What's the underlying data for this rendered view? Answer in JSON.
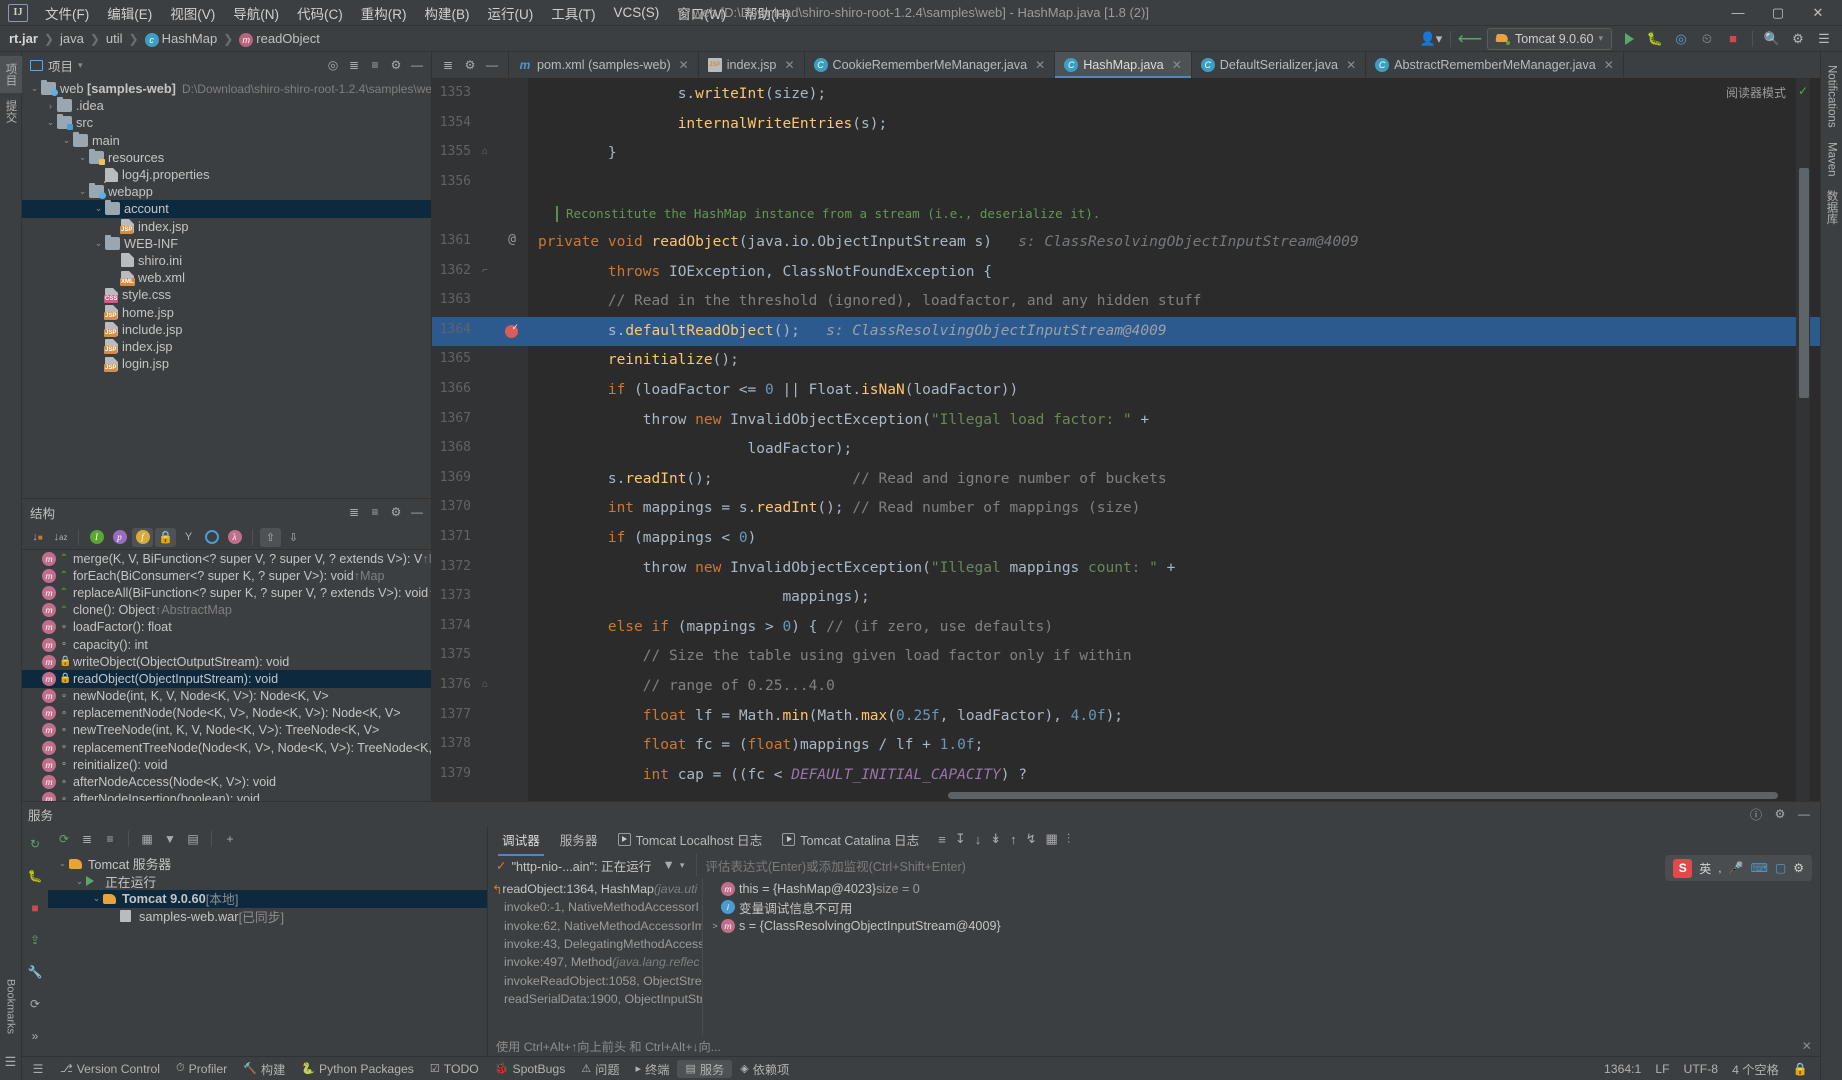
{
  "window": {
    "title": "web [D:\\Download\\shiro-shiro-root-1.2.4\\samples\\web] - HashMap.java [1.8 (2)]",
    "logo": "IJ",
    "minimize": "—",
    "maximize": "▢",
    "close": "✕"
  },
  "menu": [
    "文件(F)",
    "编辑(E)",
    "视图(V)",
    "导航(N)",
    "代码(C)",
    "重构(R)",
    "构建(B)",
    "运行(U)",
    "工具(T)",
    "VCS(S)",
    "窗口(W)",
    "帮助(H)"
  ],
  "breadcrumb": [
    {
      "label": "rt.jar",
      "bold": true,
      "icon": ""
    },
    {
      "label": "java",
      "bold": false,
      "icon": ""
    },
    {
      "label": "util",
      "bold": false,
      "icon": ""
    },
    {
      "label": "HashMap",
      "bold": false,
      "icon": "c"
    },
    {
      "label": "readObject",
      "bold": false,
      "icon": "m"
    }
  ],
  "toolbar": {
    "run_config": "Tomcat 9.0.60",
    "icons": [
      "user-icon",
      "vcs-update-icon",
      "run-icon",
      "debug-icon",
      "coverage-icon",
      "profiler-icon",
      "stop-icon",
      "search-icon",
      "settings-icon",
      "more-icon"
    ]
  },
  "left_rail": {
    "tabs": [
      "项目",
      "提交"
    ],
    "right_tabs": [
      "Notifications",
      "Maven",
      "数据库"
    ]
  },
  "project_panel": {
    "title": "项目",
    "tree": [
      {
        "depth": 0,
        "arrow": "v",
        "icon": "folder web",
        "label": "web",
        "bold": "[samples-web]",
        "dim": "D:\\Download\\shiro-shiro-root-1.2.4\\samples\\we",
        "sel": false
      },
      {
        "depth": 1,
        "arrow": ">",
        "icon": "folder",
        "label": ".idea",
        "bold": "",
        "dim": "",
        "sel": false
      },
      {
        "depth": 1,
        "arrow": "v",
        "icon": "folder src",
        "label": "src",
        "bold": "",
        "dim": "",
        "sel": false
      },
      {
        "depth": 2,
        "arrow": "v",
        "icon": "folder",
        "label": "main",
        "bold": "",
        "dim": "",
        "sel": false
      },
      {
        "depth": 3,
        "arrow": "v",
        "icon": "folder res",
        "label": "resources",
        "bold": "",
        "dim": "",
        "sel": false
      },
      {
        "depth": 4,
        "arrow": "",
        "icon": "file prop",
        "label": "log4j.properties",
        "bold": "",
        "dim": "",
        "sel": false
      },
      {
        "depth": 3,
        "arrow": "v",
        "icon": "folder web",
        "label": "webapp",
        "bold": "",
        "dim": "",
        "sel": false
      },
      {
        "depth": 4,
        "arrow": "v",
        "icon": "folder",
        "label": "account",
        "bold": "",
        "dim": "",
        "sel": true
      },
      {
        "depth": 5,
        "arrow": "",
        "icon": "file jsp",
        "label": "index.jsp",
        "bold": "",
        "dim": "",
        "sel": false
      },
      {
        "depth": 4,
        "arrow": "v",
        "icon": "folder",
        "label": "WEB-INF",
        "bold": "",
        "dim": "",
        "sel": false
      },
      {
        "depth": 5,
        "arrow": "",
        "icon": "file",
        "label": "shiro.ini",
        "bold": "",
        "dim": "",
        "sel": false
      },
      {
        "depth": 5,
        "arrow": "",
        "icon": "file xml",
        "label": "web.xml",
        "bold": "",
        "dim": "",
        "sel": false
      },
      {
        "depth": 4,
        "arrow": "",
        "icon": "file css",
        "label": "style.css",
        "bold": "",
        "dim": "",
        "sel": false
      },
      {
        "depth": 4,
        "arrow": "",
        "icon": "file jsp",
        "label": "home.jsp",
        "bold": "",
        "dim": "",
        "sel": false
      },
      {
        "depth": 4,
        "arrow": "",
        "icon": "file jsp",
        "label": "include.jsp",
        "bold": "",
        "dim": "",
        "sel": false
      },
      {
        "depth": 4,
        "arrow": "",
        "icon": "file jsp",
        "label": "index.jsp",
        "bold": "",
        "dim": "",
        "sel": false
      },
      {
        "depth": 4,
        "arrow": "",
        "icon": "file jsp",
        "label": "login.jsp",
        "bold": "",
        "dim": "",
        "sel": false
      }
    ]
  },
  "structure_panel": {
    "title": "结构",
    "items": [
      {
        "vis": "pub",
        "label": "merge(K, V, BiFunction<? super V, ? super V, ? extends V>): V",
        "up": "↑M",
        "sel": false
      },
      {
        "vis": "pub",
        "label": "forEach(BiConsumer<? super K, ? super V>): void",
        "up": "↑Map",
        "sel": false
      },
      {
        "vis": "pub",
        "label": "replaceAll(BiFunction<? super K, ? super V, ? extends V>): void",
        "up": "↑M",
        "sel": false
      },
      {
        "vis": "pub",
        "label": "clone(): Object",
        "up": "↑AbstractMap",
        "sel": false
      },
      {
        "vis": "prot",
        "label": "loadFactor(): float",
        "up": "",
        "sel": false
      },
      {
        "vis": "prot",
        "label": "capacity(): int",
        "up": "",
        "sel": false
      },
      {
        "vis": "priv",
        "label": "writeObject(ObjectOutputStream): void",
        "up": "",
        "sel": false
      },
      {
        "vis": "priv",
        "label": "readObject(ObjectInputStream): void",
        "up": "",
        "sel": true
      },
      {
        "vis": "prot",
        "label": "newNode(int, K, V, Node<K, V>): Node<K, V>",
        "up": "",
        "sel": false
      },
      {
        "vis": "prot",
        "label": "replacementNode(Node<K, V>, Node<K, V>): Node<K, V>",
        "up": "",
        "sel": false
      },
      {
        "vis": "prot",
        "label": "newTreeNode(int, K, V, Node<K, V>): TreeNode<K, V>",
        "up": "",
        "sel": false
      },
      {
        "vis": "prot",
        "label": "replacementTreeNode(Node<K, V>, Node<K, V>): TreeNode<K,",
        "up": "",
        "sel": false
      },
      {
        "vis": "prot",
        "label": "reinitialize(): void",
        "up": "",
        "sel": false
      },
      {
        "vis": "prot",
        "label": "afterNodeAccess(Node<K, V>): void",
        "up": "",
        "sel": false
      },
      {
        "vis": "prot",
        "label": "afterNodeInsertion(boolean): void",
        "up": "",
        "sel": false
      }
    ]
  },
  "editor": {
    "tabs": [
      {
        "label": "pom.xml (samples-web)",
        "icon": "m",
        "active": false
      },
      {
        "label": "index.jsp",
        "icon": "jsp",
        "active": false
      },
      {
        "label": "CookieRememberMeManager.java",
        "icon": "c",
        "active": false
      },
      {
        "label": "HashMap.java",
        "icon": "c",
        "active": true
      },
      {
        "label": "DefaultSerializer.java",
        "icon": "c",
        "active": false
      },
      {
        "label": "AbstractRememberMeManager.java",
        "icon": "c",
        "active": false
      }
    ],
    "reader_mode": "阅读器模式",
    "javadoc": "Reconstitute the HashMap instance from a stream (i.e., deserialize it).",
    "lines": [
      {
        "n": "1353",
        "text": "s.writeInt(size);",
        "indent": 4
      },
      {
        "n": "1354",
        "text": "internalWriteEntries(s);",
        "indent": 4
      },
      {
        "n": "1355",
        "text": "}",
        "indent": 2,
        "fold": "⌂"
      },
      {
        "n": "1356",
        "text": "",
        "indent": 0
      },
      {
        "n": "",
        "text": "",
        "indent": 0
      },
      {
        "n": "1361",
        "text": "private void readObject(java.io.ObjectInputStream s)",
        "indent": 0,
        "annot": "@",
        "hint": "s: ClassResolvingObjectInputStream@4009"
      },
      {
        "n": "1362",
        "text": "throws IOException, ClassNotFoundException {",
        "indent": 2,
        "fold": "⌐"
      },
      {
        "n": "1363",
        "text": "// Read in the threshold (ignored), loadfactor, and any hidden stuff",
        "indent": 2
      },
      {
        "n": "1364",
        "text": "s.defaultReadObject();",
        "indent": 2,
        "hl": true,
        "bp": true,
        "hint": "s: ClassResolvingObjectInputStream@4009"
      },
      {
        "n": "1365",
        "text": "reinitialize();",
        "indent": 2
      },
      {
        "n": "1366",
        "text": "if (loadFactor <= 0 || Float.isNaN(loadFactor))",
        "indent": 2
      },
      {
        "n": "1367",
        "text": "throw new InvalidObjectException(\"Illegal load factor: \" +",
        "indent": 3
      },
      {
        "n": "1368",
        "text": "loadFactor);",
        "indent": 6
      },
      {
        "n": "1369",
        "text": "s.readInt();                // Read and ignore number of buckets",
        "indent": 2
      },
      {
        "n": "1370",
        "text": "int mappings = s.readInt(); // Read number of mappings (size)",
        "indent": 2
      },
      {
        "n": "1371",
        "text": "if (mappings < 0)",
        "indent": 2
      },
      {
        "n": "1372",
        "text": "throw new InvalidObjectException(\"Illegal mappings count: \" +",
        "indent": 3
      },
      {
        "n": "1373",
        "text": "mappings);",
        "indent": 7
      },
      {
        "n": "1374",
        "text": "else if (mappings > 0) { // (if zero, use defaults)",
        "indent": 2
      },
      {
        "n": "1375",
        "text": "// Size the table using given load factor only if within",
        "indent": 3
      },
      {
        "n": "1376",
        "text": "// range of 0.25...4.0",
        "indent": 3,
        "fold": "⌂"
      },
      {
        "n": "1377",
        "text": "float lf = Math.min(Math.max(0.25f, loadFactor), 4.0f);",
        "indent": 3
      },
      {
        "n": "1378",
        "text": "float fc = (float)mappings / lf + 1.0f;",
        "indent": 3
      },
      {
        "n": "1379",
        "text": "int cap = ((fc < DEFAULT_INITIAL_CAPACITY) ?",
        "indent": 3
      }
    ]
  },
  "services": {
    "title": "服务",
    "tree": [
      {
        "depth": 0,
        "arrow": "v",
        "label": "Tomcat 服务器",
        "icon": "tomcat",
        "sel": false,
        "bold": false
      },
      {
        "depth": 1,
        "arrow": "v",
        "label": "正在运行",
        "icon": "play",
        "sel": false,
        "bold": false
      },
      {
        "depth": 2,
        "arrow": "v",
        "label": "Tomcat 9.0.60",
        "suffix": "[本地]",
        "icon": "tomcat",
        "sel": true,
        "bold": true
      },
      {
        "depth": 3,
        "arrow": "",
        "label": "samples-web.war",
        "suffix": "[已同步]",
        "icon": "war",
        "sel": false,
        "bold": false
      }
    ]
  },
  "debugger": {
    "tabs": [
      {
        "label": "调试器",
        "active": true,
        "icon": ""
      },
      {
        "label": "服务器",
        "active": false,
        "icon": ""
      },
      {
        "label": "Tomcat Localhost 日志",
        "active": false,
        "icon": "play"
      },
      {
        "label": "Tomcat Catalina 日志",
        "active": false,
        "icon": "play"
      }
    ],
    "thread": "\"http-nio-...ain\": 正在运行",
    "watch_placeholder": "评估表达式(Enter)或添加监视(Ctrl+Shift+Enter)",
    "frames": [
      {
        "label": "readObject:1364, HashMap",
        "ital": "(java.uti",
        "top": true
      },
      {
        "label": "invoke0:-1, NativeMethodAccessorI",
        "ital": "",
        "top": false
      },
      {
        "label": "invoke:62, NativeMethodAccessorIm",
        "ital": "",
        "top": false
      },
      {
        "label": "invoke:43, DelegatingMethodAccess",
        "ital": "",
        "top": false
      },
      {
        "label": "invoke:497, Method",
        "ital": "(java.lang.reflec",
        "top": false
      },
      {
        "label": "invokeReadObject:1058, ObjectStrea",
        "ital": "",
        "top": false
      },
      {
        "label": "readSerialData:1900, ObjectInputStr",
        "ital": "",
        "top": false
      }
    ],
    "variables": [
      {
        "icon": "m",
        "label": "this = {HashMap@4023}",
        "val": "size = 0",
        "arrow": ""
      },
      {
        "icon": "i",
        "label": "变量调试信息不可用",
        "val": "",
        "arrow": ""
      },
      {
        "icon": "m",
        "label": "s = {ClassResolvingObjectInputStream@4009}",
        "val": "",
        "arrow": ">"
      }
    ],
    "hint": "使用 Ctrl+Alt+↑向上前头 和 Ctrl+Alt+↓向..."
  },
  "statusbar": {
    "left": [
      {
        "label": "Version Control",
        "icon": "branch-icon"
      },
      {
        "label": "Profiler",
        "icon": "profiler-icon"
      },
      {
        "label": "构建",
        "icon": "build-icon"
      },
      {
        "label": "Python Packages",
        "icon": "python-icon"
      },
      {
        "label": "TODO",
        "icon": "todo-icon"
      },
      {
        "label": "SpotBugs",
        "icon": "bug-icon"
      },
      {
        "label": "问题",
        "icon": "problems-icon"
      },
      {
        "label": "终端",
        "icon": "terminal-icon"
      },
      {
        "label": "服务",
        "icon": "services-icon",
        "active": true
      },
      {
        "label": "依赖项",
        "icon": "deps-icon"
      }
    ],
    "right": [
      "1364:1",
      "LF",
      "UTF-8",
      "4 个空格"
    ]
  },
  "ime": {
    "lang": "英",
    "icons": [
      "punct-icon",
      "mic-icon",
      "keyboard-icon",
      "board-icon",
      "settings-icon"
    ]
  }
}
